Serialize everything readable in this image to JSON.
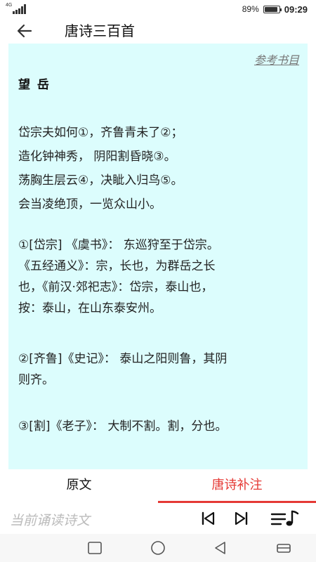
{
  "status_bar": {
    "network": "4G",
    "battery": "89%",
    "battery_level": 0.89,
    "time": "09:29"
  },
  "header": {
    "title": "唐诗三百首",
    "back_icon": "arrow-left-icon"
  },
  "content": {
    "ref_link": "参考书目",
    "poem_title": "望 岳",
    "poem_lines": [
      "岱宗夫如何①，齐鲁青未了②；",
      "造化钟神秀， 阴阳割昏晓③。",
      "荡胸生层云④，决眦入归鸟⑤。",
      "会当凌绝顶，一览众山小。"
    ],
    "notes": [
      [
        "①[岱宗] 《虞书》： 东巡狩至于岱宗。",
        "《五经通义》：宗，长也，为群岳之长",
        "也，《前汉·郊祀志》：岱宗，泰山也，",
        "按：泰山，在山东泰安州。"
      ],
      [
        "②[齐鲁]《史记》： 泰山之阳则鲁，其阴",
        "则齐。"
      ],
      [
        "③[割]《老子》： 大制不割。割，分也。"
      ]
    ]
  },
  "tabs": [
    {
      "label": "原文",
      "active": false
    },
    {
      "label": "唐诗补注",
      "active": true
    }
  ],
  "player": {
    "now_reading": "当前诵读诗文",
    "icons": [
      "skip-previous-icon",
      "skip-next-icon",
      "playlist-music-icon"
    ]
  },
  "nav_bar": {
    "icons": [
      "recent-apps-icon",
      "home-icon",
      "back-icon",
      "notifications-icon"
    ]
  },
  "colors": {
    "content_bg": "#dcfdfd",
    "accent": "#e53935",
    "muted": "#bbbbbb"
  }
}
